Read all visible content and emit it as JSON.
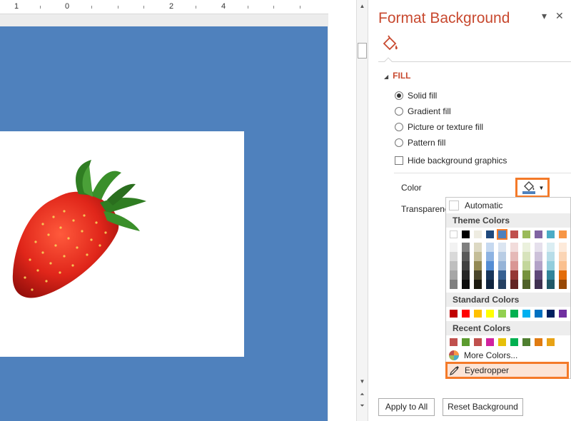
{
  "ruler": {
    "labels": [
      "1",
      "0",
      "2",
      "4"
    ]
  },
  "pane": {
    "title": "Format Background",
    "section_fill": "FILL",
    "fill_options": [
      {
        "label": "Solid fill",
        "selected": true
      },
      {
        "label": "Gradient fill",
        "selected": false
      },
      {
        "label": "Picture or texture fill",
        "selected": false
      },
      {
        "label": "Pattern fill",
        "selected": false
      }
    ],
    "hide_bg_graphics": "Hide background graphics",
    "color_label": "Color",
    "transparency_label": "Transparenc",
    "apply_all": "Apply to All",
    "reset_bg": "Reset Background",
    "accent": "#c8492f",
    "highlight": "#f47a29"
  },
  "color_menu": {
    "automatic": "Automatic",
    "theme_header": "Theme Colors",
    "theme_top": [
      "#ffffff",
      "#000000",
      "#eeece1",
      "#1f497d",
      "#4f81bd",
      "#c0504d",
      "#9bbb59",
      "#8064a2",
      "#4bacc6",
      "#f79646"
    ],
    "theme_selected_index": 4,
    "theme_shades": [
      [
        "#f2f2f2",
        "#d9d9d9",
        "#bfbfbf",
        "#a6a6a6",
        "#808080"
      ],
      [
        "#7f7f7f",
        "#595959",
        "#404040",
        "#262626",
        "#0d0d0d"
      ],
      [
        "#ddd9c3",
        "#c4bd97",
        "#938953",
        "#4a452a",
        "#1d1b10"
      ],
      [
        "#c6d9f0",
        "#8db3e2",
        "#548dd4",
        "#17365d",
        "#0f243e"
      ],
      [
        "#dbe5f1",
        "#b8cce4",
        "#95b3d7",
        "#366092",
        "#244061"
      ],
      [
        "#f2dcdb",
        "#e5b9b7",
        "#d99694",
        "#953734",
        "#632423"
      ],
      [
        "#ebf1dd",
        "#d7e3bc",
        "#c3d69b",
        "#76923c",
        "#4f6128"
      ],
      [
        "#e5e0ec",
        "#ccc1d9",
        "#b2a2c7",
        "#5f497a",
        "#3f3151"
      ],
      [
        "#dbeef3",
        "#b7dde8",
        "#92cddc",
        "#31859b",
        "#205867"
      ],
      [
        "#fdeada",
        "#fbd5b5",
        "#fac08f",
        "#e36c09",
        "#974806"
      ]
    ],
    "standard_header": "Standard Colors",
    "standard": [
      "#c00000",
      "#ff0000",
      "#ffc000",
      "#ffff00",
      "#92d050",
      "#00b050",
      "#00b0f0",
      "#0070c0",
      "#002060",
      "#7030a0"
    ],
    "recent_header": "Recent Colors",
    "recent": [
      "#c0504d",
      "#5b9b2f",
      "#c0504d",
      "#d1229f",
      "#e6c00a",
      "#00b050",
      "#4f7f30",
      "#e07b11",
      "#e8a315"
    ],
    "more_colors": "More Colors...",
    "eyedropper": "Eyedropper"
  }
}
